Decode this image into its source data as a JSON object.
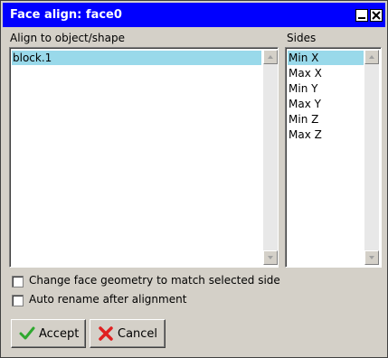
{
  "window": {
    "title": "Face align: face0"
  },
  "objects": {
    "label": "Align to object/shape",
    "items": [
      "block.1"
    ],
    "selected": "block.1"
  },
  "sides": {
    "label": "Sides",
    "items": [
      "Min X",
      "Max X",
      "Min Y",
      "Max Y",
      "Min Z",
      "Max Z"
    ],
    "selected": "Min X"
  },
  "options": {
    "change_geometry": {
      "label": "Change face geometry to match selected side",
      "checked": false
    },
    "auto_rename": {
      "label": "Auto rename after alignment",
      "checked": false
    }
  },
  "buttons": {
    "accept": "Accept",
    "cancel": "Cancel"
  },
  "icons": {
    "accept": "check-mark-icon",
    "cancel": "red-x-icon",
    "minimize": "minimize-icon",
    "close": "close-icon"
  },
  "colors": {
    "titlebar": "#0000ff",
    "selection": "#99d9ea",
    "accept_icon": "#2fa82f",
    "cancel_icon": "#e02020"
  }
}
